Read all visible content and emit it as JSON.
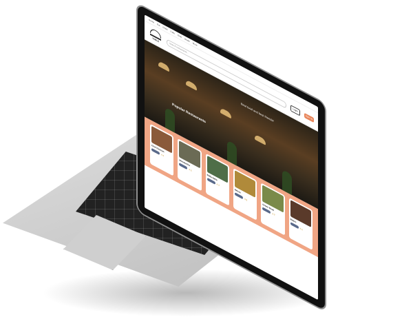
{
  "site": {
    "logo_text": "TABLE",
    "search_placeholder": "Search restaurants...",
    "nav": [
      "Home",
      "Eat",
      "Drink",
      "Cafe",
      "Dine",
      "Deals",
      "More"
    ],
    "login_label": "Login",
    "signup_label": "Sign Up",
    "hero_text": "Best food and best friends!",
    "section_title": "Popular Restaurants",
    "cards": [
      {
        "name": "Chef Kitchen",
        "rating": "4.4"
      },
      {
        "name": "Moustache",
        "rating": "4.5"
      },
      {
        "name": "Bella Italia",
        "rating": "4.3"
      },
      {
        "name": "Mezze",
        "rating": "4.6"
      },
      {
        "name": "Green Bowl",
        "rating": "4.2"
      },
      {
        "name": "Bistro",
        "rating": "4.5"
      }
    ]
  },
  "colors": {
    "accent": "#e8855a",
    "strip": "#f0a584",
    "pill": "#5a6a8a"
  }
}
